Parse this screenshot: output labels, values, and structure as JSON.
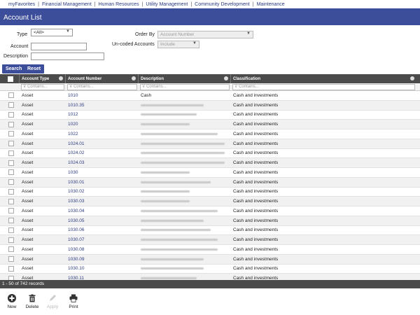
{
  "topnav": [
    "myFavorites",
    "Financial Management",
    "Human Resources",
    "Utility Management",
    "Community Development",
    "Maintenance"
  ],
  "page_title": "Account List",
  "filters": {
    "type_label": "Type",
    "type_value": "<All>",
    "account_label": "Account",
    "description_label": "Description",
    "orderby_label": "Order By",
    "orderby_value": "Account Number",
    "uncoded_label": "Un-coded Accounts",
    "uncoded_value": "Include",
    "search_label": "Search",
    "reset_label": "Reset"
  },
  "grid": {
    "columns": [
      "Account Type",
      "Account Number",
      "Description",
      "Classification"
    ],
    "filter_placeholder": "Contains...",
    "rows": [
      {
        "type": "Asset",
        "number": "1010",
        "description": "Cash",
        "classification": "Cash and investments"
      },
      {
        "type": "Asset",
        "number": "1010.35",
        "description": "",
        "classification": "Cash and investments"
      },
      {
        "type": "Asset",
        "number": "1012",
        "description": "",
        "classification": "Cash and investments"
      },
      {
        "type": "Asset",
        "number": "1020",
        "description": "",
        "classification": "Cash and investments"
      },
      {
        "type": "Asset",
        "number": "1022",
        "description": "",
        "classification": "Cash and investments"
      },
      {
        "type": "Asset",
        "number": "1024.01",
        "description": "",
        "classification": "Cash and investments"
      },
      {
        "type": "Asset",
        "number": "1024.02",
        "description": "",
        "classification": "Cash and investments"
      },
      {
        "type": "Asset",
        "number": "1024.03",
        "description": "",
        "classification": "Cash and investments"
      },
      {
        "type": "Asset",
        "number": "1030",
        "description": "",
        "classification": "Cash and investments"
      },
      {
        "type": "Asset",
        "number": "1030.01",
        "description": "",
        "classification": "Cash and investments"
      },
      {
        "type": "Asset",
        "number": "1030.02",
        "description": "",
        "classification": "Cash and investments"
      },
      {
        "type": "Asset",
        "number": "1030.03",
        "description": "",
        "classification": "Cash and investments"
      },
      {
        "type": "Asset",
        "number": "1030.04",
        "description": "",
        "classification": "Cash and investments"
      },
      {
        "type": "Asset",
        "number": "1030.05",
        "description": "",
        "classification": "Cash and investments"
      },
      {
        "type": "Asset",
        "number": "1030.06",
        "description": "",
        "classification": "Cash and investments"
      },
      {
        "type": "Asset",
        "number": "1030.07",
        "description": "",
        "classification": "Cash and investments"
      },
      {
        "type": "Asset",
        "number": "1030.08",
        "description": "",
        "classification": "Cash and investments"
      },
      {
        "type": "Asset",
        "number": "1030.09",
        "description": "",
        "classification": "Cash and investments"
      },
      {
        "type": "Asset",
        "number": "1030.10",
        "description": "",
        "classification": "Cash and investments"
      },
      {
        "type": "Asset",
        "number": "1030.11",
        "description": "",
        "classification": "Cash and investments"
      }
    ]
  },
  "status": "1 - 50 of 742 records",
  "toolbar": {
    "new": "New",
    "delete": "Delete",
    "apply": "Apply",
    "print": "Print"
  },
  "colors": {
    "accent": "#3c4e9a",
    "header": "#4b4b4b",
    "link": "#2a3a80"
  }
}
